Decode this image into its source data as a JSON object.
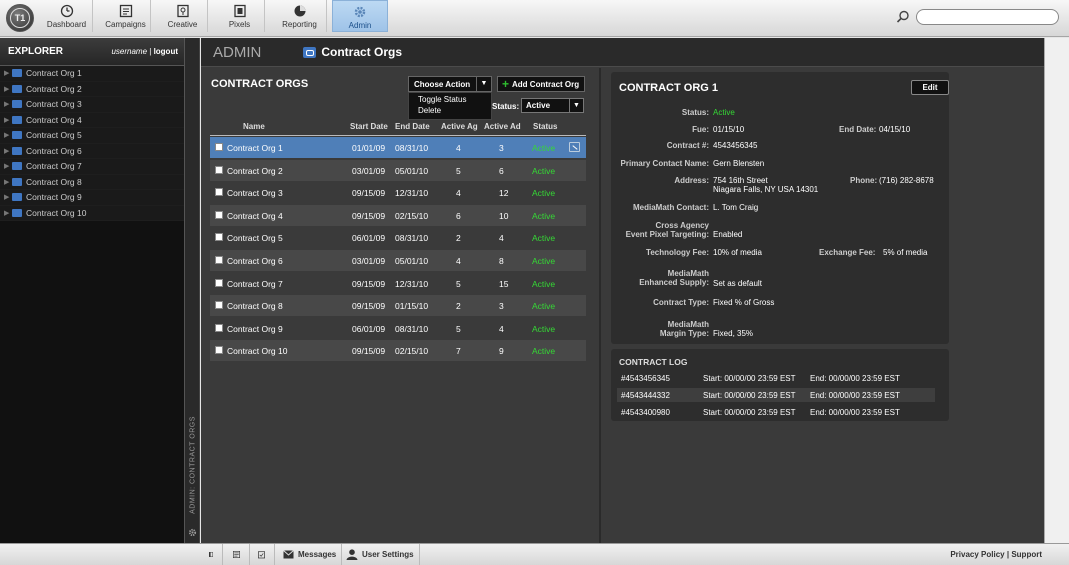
{
  "logo": {
    "text": "T1"
  },
  "nav": [
    {
      "label": "Dashboard",
      "icon": "dashboard-icon"
    },
    {
      "label": "Campaigns",
      "icon": "campaigns-icon"
    },
    {
      "label": "Creative",
      "icon": "creative-icon"
    },
    {
      "label": "Pixels",
      "icon": "pixels-icon"
    },
    {
      "label": "Reporting",
      "icon": "reporting-icon"
    },
    {
      "label": "Admin",
      "icon": "gear-icon",
      "active": true
    }
  ],
  "search": {
    "placeholder": ""
  },
  "explorer": {
    "title": "EXPLORER",
    "username": "username",
    "separator": "|",
    "logout": "logout",
    "items": [
      "Contract Org 1",
      "Contract Org 2",
      "Contract Org 3",
      "Contract Org 4",
      "Contract Org 5",
      "Contract Org 6",
      "Contract Org 7",
      "Contract Org 8",
      "Contract Org 9",
      "Contract Org 10"
    ],
    "vertical_label": "ADMIN: CONTRACT ORGS"
  },
  "header": {
    "section": "ADMIN",
    "page": "Contract Orgs"
  },
  "list": {
    "title": "CONTRACT ORGS",
    "choose_action": "Choose Action",
    "action_menu": [
      "Toggle Status",
      "Delete"
    ],
    "add_button": "Add Contract Org",
    "status_label": "Status:",
    "status_value": "Active",
    "columns": [
      "Name",
      "Start Date",
      "End Date",
      "Active Ag",
      "Active Ad",
      "Status"
    ],
    "rows": [
      {
        "name": "Contract Org 1",
        "start": "01/01/09",
        "end": "08/31/10",
        "ag": "4",
        "ad": "3",
        "status": "Active"
      },
      {
        "name": "Contract Org 2",
        "start": "03/01/09",
        "end": "05/01/10",
        "ag": "5",
        "ad": "6",
        "status": "Active"
      },
      {
        "name": "Contract Org 3",
        "start": "09/15/09",
        "end": "12/31/10",
        "ag": "4",
        "ad": "12",
        "status": "Active"
      },
      {
        "name": "Contract Org 4",
        "start": "09/15/09",
        "end": "02/15/10",
        "ag": "6",
        "ad": "10",
        "status": "Active"
      },
      {
        "name": "Contract Org 5",
        "start": "06/01/09",
        "end": "08/31/10",
        "ag": "2",
        "ad": "4",
        "status": "Active"
      },
      {
        "name": "Contract Org 6",
        "start": "03/01/09",
        "end": "05/01/10",
        "ag": "4",
        "ad": "8",
        "status": "Active"
      },
      {
        "name": "Contract Org 7",
        "start": "09/15/09",
        "end": "12/31/10",
        "ag": "5",
        "ad": "15",
        "status": "Active"
      },
      {
        "name": "Contract Org 8",
        "start": "09/15/09",
        "end": "01/15/10",
        "ag": "2",
        "ad": "3",
        "status": "Active"
      },
      {
        "name": "Contract Org 9",
        "start": "06/01/09",
        "end": "08/31/10",
        "ag": "5",
        "ad": "4",
        "status": "Active"
      },
      {
        "name": "Contract Org 10",
        "start": "09/15/09",
        "end": "02/15/10",
        "ag": "7",
        "ad": "9",
        "status": "Active"
      }
    ]
  },
  "detail": {
    "title": "CONTRACT ORG 1",
    "edit": "Edit",
    "status_label": "Status:",
    "status_value": "Active",
    "fue_label": "Fue:",
    "fue_value": "01/15/10",
    "end_date_label": "End Date:",
    "end_date_value": "04/15/10",
    "contract_label": "Contract #:",
    "contract_value": "4543456345",
    "primary_label": "Primary Contact Name:",
    "primary_value": "Gern Blensten",
    "address_label": "Address:",
    "address_line1": "754 16th Street",
    "address_line2": "Niagara Falls, NY USA 14301",
    "phone_label": "Phone:",
    "phone_value": "(716) 282-8678",
    "mm_contact_label": "MediaMath Contact:",
    "mm_contact_value": "L. Tom Craig",
    "cross_label_1": "Cross Agency",
    "cross_label_2": "Event Pixel Targeting:",
    "cross_value": "Enabled",
    "tech_fee_label": "Technology Fee:",
    "tech_fee_value": "10% of media",
    "exchange_fee_label": "Exchange Fee:",
    "exchange_fee_value": "5% of media",
    "enhanced_label_1": "MediaMath",
    "enhanced_label_2": "Enhanced Supply:",
    "enhanced_value": "Set as default",
    "contract_type_label": "Contract Type:",
    "contract_type_value": "Fixed % of Gross",
    "margin_label_1": "MediaMath",
    "margin_label_2": "Margin Type:",
    "margin_value": "Fixed, 35%"
  },
  "log": {
    "title": "CONTRACT LOG",
    "rows": [
      {
        "id": "#4543456345",
        "start": "Start: 00/00/00 23:59 EST",
        "end": "End: 00/00/00 23:59 EST"
      },
      {
        "id": "#4543444332",
        "start": "Start: 00/00/00 23:59 EST",
        "end": "End: 00/00/00 23:59 EST"
      },
      {
        "id": "#4543400980",
        "start": "Start: 00/00/00 23:59 EST",
        "end": "End: 00/00/00 23:59 EST"
      }
    ]
  },
  "footer": {
    "messages": "Messages",
    "user_settings": "User Settings",
    "privacy": "Privacy Policy",
    "sep": "|",
    "support": "Support"
  },
  "colors": {
    "accent": "#4f7fb8",
    "active_status": "#35d935",
    "add_plus": "#2fbd2f"
  }
}
